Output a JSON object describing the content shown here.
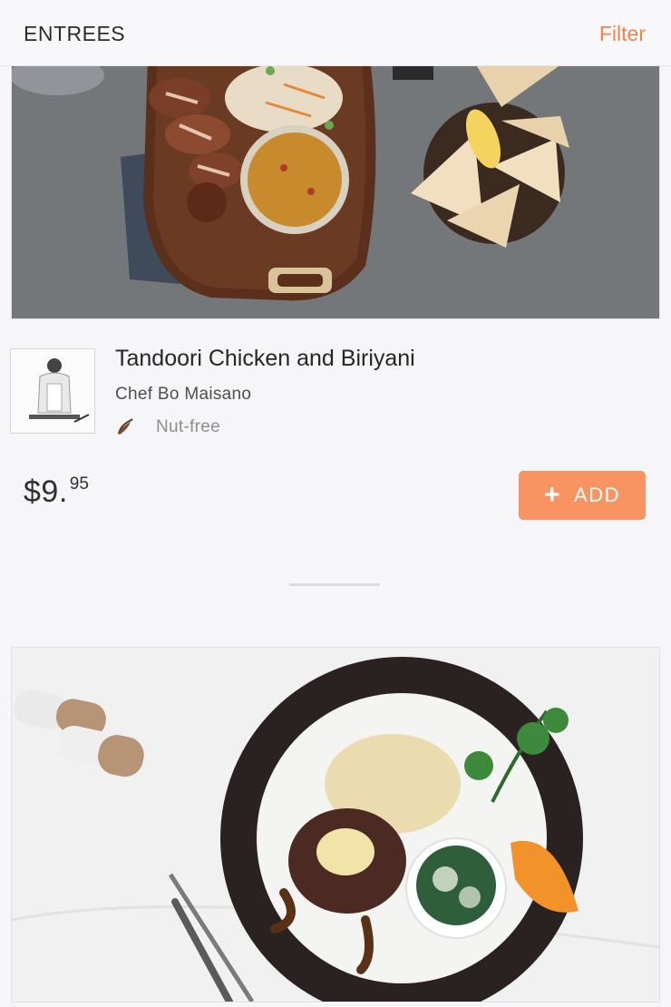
{
  "header": {
    "title": "ENTREES",
    "filter_label": "Filter"
  },
  "meal": {
    "title": "Tandoori Chicken and Biriyani",
    "chef": "Chef Bo Maisano",
    "diet_icon": "chili-pepper-icon",
    "diet_label": "Nut-free",
    "price_dollars": "$9.",
    "price_cents": "95",
    "add_icon": "plus-icon",
    "add_label": "ADD"
  },
  "colors": {
    "accent": "#f0844a",
    "button": "#f79462",
    "background": "#f6f6f8"
  }
}
